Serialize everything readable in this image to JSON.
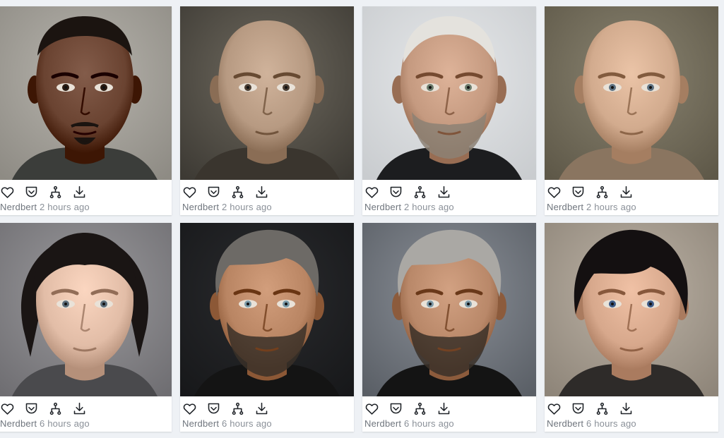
{
  "icons": [
    "heart-icon",
    "pocket-save-icon",
    "hierarchy-icon",
    "download-icon"
  ],
  "colors": {
    "icon_stroke": "#1f2328",
    "meta_text": "#8a9098",
    "card_bg": "#ffffff",
    "page_bg": "#eef1f5"
  },
  "cards": [
    {
      "author": "Nerdbert",
      "time": "2 hours ago",
      "skin": "#6a4331",
      "bg1": "#b7b4ad",
      "bg2": "#8e8b84",
      "hair": "#1b1410",
      "hair_style": "short",
      "beard": "goatee",
      "eyes": "#2a1a10",
      "shirt": "#3b3d3a"
    },
    {
      "author": "Nerdbert",
      "time": "2 hours ago",
      "skin": "#b79a82",
      "bg1": "#6f6a5f",
      "bg2": "#3d3a34",
      "hair": null,
      "hair_style": "bald",
      "beard": "none",
      "eyes": "#4a3c30",
      "shirt": "#3a352e"
    },
    {
      "author": "Nerdbert",
      "time": "2 hours ago",
      "skin": "#c59a80",
      "bg1": "#e6e8ea",
      "bg2": "#c9cccf",
      "hair": "#e4e2dd",
      "hair_style": "buzz",
      "beard": "grey",
      "eyes": "#6a7a6a",
      "shirt": "#1c1d1f"
    },
    {
      "author": "Nerdbert",
      "time": "2 hours ago",
      "skin": "#d2ab8e",
      "bg1": "#8a8471",
      "bg2": "#5e5848",
      "hair": null,
      "hair_style": "bald",
      "beard": "none",
      "eyes": "#5c7080",
      "shirt": "#8a7560"
    },
    {
      "author": "Nerdbert",
      "time": "6 hours ago",
      "skin": "#e2bda7",
      "bg1": "#9b9a9d",
      "bg2": "#6f6e72",
      "hair": "#1a1514",
      "hair_style": "bob",
      "beard": "none",
      "eyes": "#5c6d7a",
      "shirt": "#4a4a4d"
    },
    {
      "author": "Nerdbert",
      "time": "6 hours ago",
      "skin": "#b98563",
      "bg1": "#2a2b2e",
      "bg2": "#17181a",
      "hair": "#6d6a66",
      "hair_style": "swept",
      "beard": "dark",
      "eyes": "#7a9aa8",
      "shirt": "#141414"
    },
    {
      "author": "Nerdbert",
      "time": "6 hours ago",
      "skin": "#b98869",
      "bg1": "#8b9098",
      "bg2": "#5a5f66",
      "hair": "#aaa8a4",
      "hair_style": "swept",
      "beard": "dark",
      "eyes": "#7c98a6",
      "shirt": "#141414"
    },
    {
      "author": "Nerdbert",
      "time": "6 hours ago",
      "skin": "#d7a88c",
      "bg1": "#bdb3a6",
      "bg2": "#8e8579",
      "hair": "#141011",
      "hair_style": "pixie",
      "beard": "none",
      "eyes": "#3d5a86",
      "shirt": "#2e2b29"
    }
  ]
}
